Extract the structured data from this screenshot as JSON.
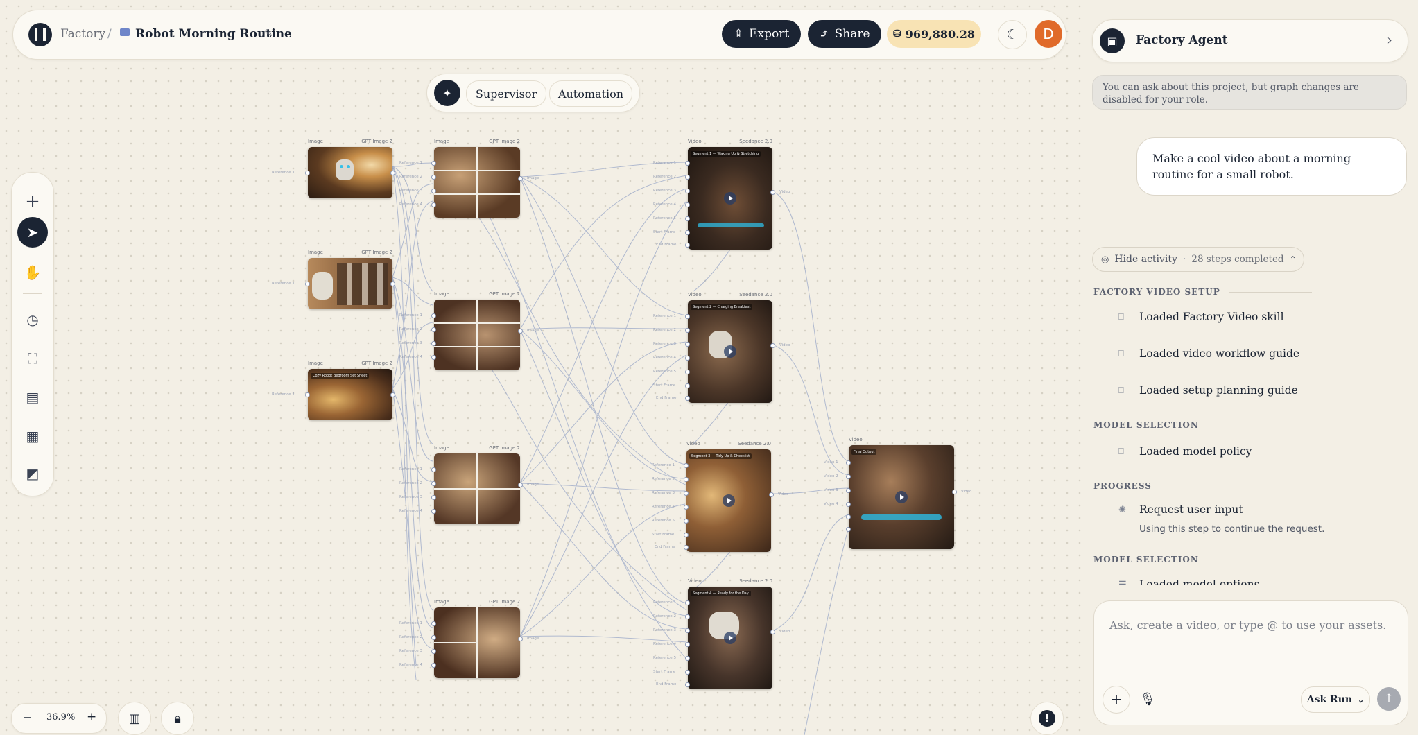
{
  "header": {
    "breadcrumb_root": "Factory",
    "separator": "/",
    "project_title": "Robot Morning Routine",
    "export_label": "Export",
    "share_label": "Share",
    "credits": "969,880.28",
    "avatar_initial": "D"
  },
  "modes": {
    "supervisor_label": "Supervisor",
    "automation_label": "Automation"
  },
  "zoom": {
    "level": "36.9%",
    "minus": "−",
    "plus": "+"
  },
  "nodes": {
    "image_type": "Image",
    "video_type": "Video",
    "image_model": "GPT Image 2",
    "video_model": "Seedance 2.0",
    "captions": {
      "img3": "Cozy Robot Bedroom Set Sheet",
      "v1": "Segment 1 — Waking Up & Stretching",
      "v2": "Segment 2 — Charging Breakfast",
      "v3": "Segment 3 — Tidy Up & Checklist",
      "v4": "Segment 4 — Ready for the Day",
      "final": "Final Output"
    },
    "port_labels": {
      "ref1": "Reference 1",
      "ref2": "Reference 2",
      "ref3": "Reference 3",
      "ref4": "Reference 4",
      "ref5": "Reference 5",
      "start": "Start Frame",
      "end": "End Frame",
      "out": "Video",
      "out_image": "Image",
      "vin1": "Video 1",
      "vin2": "Video 2",
      "vin3": "Video 3",
      "vin4": "Video 4"
    }
  },
  "panel": {
    "agent_title": "Factory Agent",
    "notice": "You can ask about this project, but graph changes are disabled for your role.",
    "user_message": "Make a cool video about a morning routine for a small robot.",
    "activity_label": "Hide activity",
    "activity_dot": "·",
    "activity_count": "28 steps completed",
    "sections": {
      "setup": "FACTORY VIDEO SETUP",
      "model1": "MODEL SELECTION",
      "progress": "PROGRESS",
      "model2": "MODEL SELECTION"
    },
    "steps": {
      "s1": "Loaded Factory Video skill",
      "s2": "Loaded video workflow guide",
      "s3": "Loaded setup planning guide",
      "s4": "Loaded model policy",
      "s5": "Request user input",
      "s5_sub": "Using this step to continue the request.",
      "s6": "Loaded model options"
    },
    "composer_placeholder": "Ask, create a video, or type @ to use your assets...",
    "run_mode": "Ask Run"
  },
  "colors": {
    "navy": "#1b2433",
    "background": "#f3efe5",
    "credits_bg": "#f8e3b4",
    "avatar": "#e06a2a",
    "edge": "#9aa8c8"
  }
}
